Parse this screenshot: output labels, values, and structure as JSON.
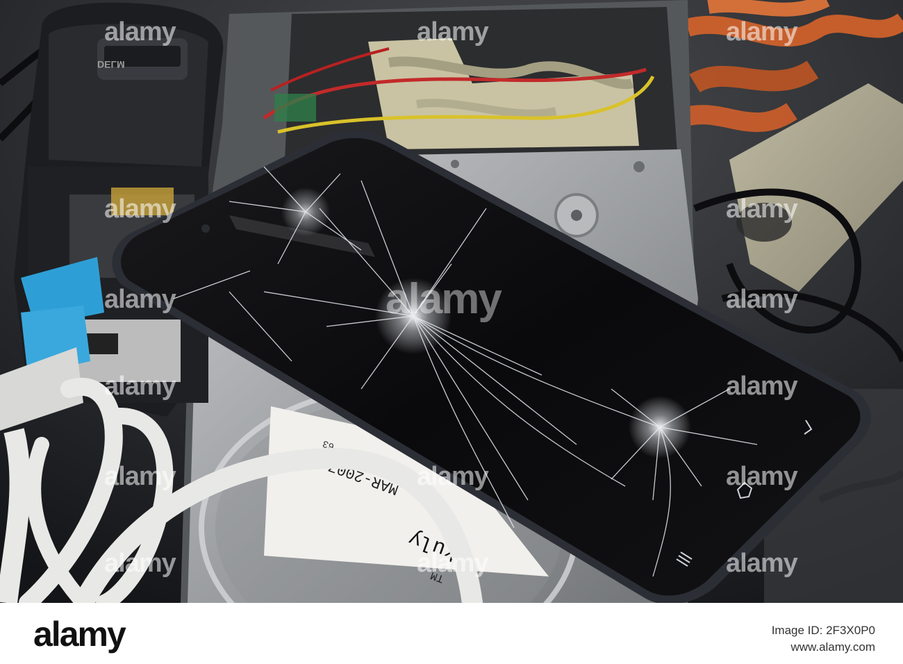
{
  "photo": {
    "alt": "Smartphone with cracked screen on top of hard drive, cables and old phone",
    "watermarks": [
      "alamy",
      "alamy",
      "alamy",
      "alamy",
      "alamy",
      "alamy",
      "alamy",
      "alamy",
      "alamy",
      "alamy",
      "alamy",
      "alamy",
      "alamy",
      "alamy",
      "alamy",
      "alamy"
    ],
    "label_texts": [
      "MAR-2007",
      "TM",
      "63",
      "kuly"
    ],
    "phone_label": "DELM",
    "colors": {
      "screen": "#0b0b0d",
      "hdd": "#a9abad",
      "cable_white": "#e8e8e6",
      "connector_blue": "#2e9fd6",
      "cable_orange": "#e0662a"
    }
  },
  "footer": {
    "brand": "alamy",
    "image_id_label": "Image ID: 2F3X0P0",
    "site": "www.alamy.com"
  }
}
